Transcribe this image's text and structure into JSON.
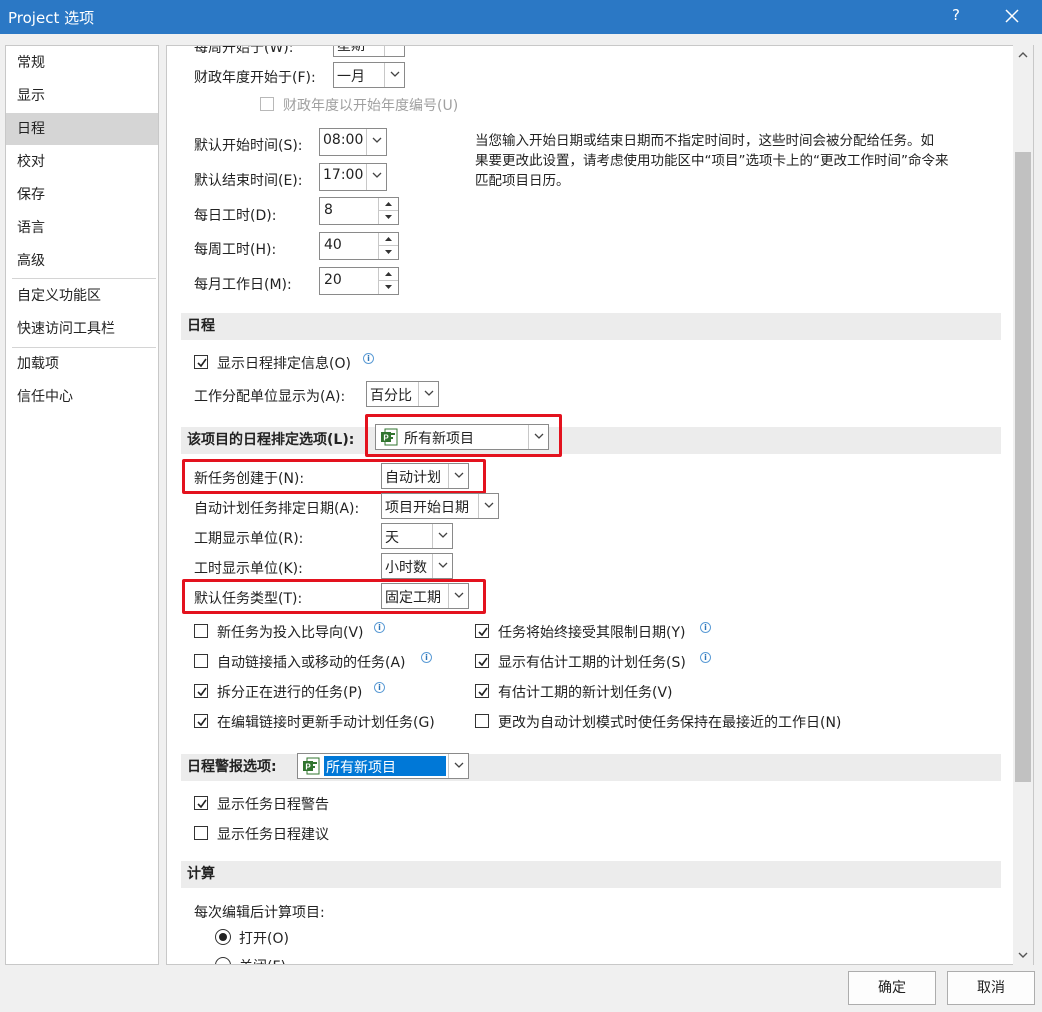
{
  "window": {
    "title": "Project 选项",
    "help": "?"
  },
  "nav": {
    "items": [
      "常规",
      "显示",
      "日程",
      "校对",
      "保存",
      "语言",
      "高级",
      "自定义功能区",
      "快速访问工具栏",
      "加载项",
      "信任中心"
    ],
    "selected": "日程"
  },
  "calendar": {
    "week_start_label": "每周开始于(W):",
    "week_start_value": "星期",
    "fiscal_start_label": "财政年度开始于(F):",
    "fiscal_start_value": "一月",
    "fiscal_numbering_label": "财政年度以开始年度编号(U)",
    "default_start_label": "默认开始时间(S):",
    "default_start_value": "08:00",
    "default_end_label": "默认结束时间(E):",
    "default_end_value": "17:00",
    "hours_day_label": "每日工时(D):",
    "hours_day_value": "8",
    "hours_week_label": "每周工时(H):",
    "hours_week_value": "40",
    "days_month_label": "每月工作日(M):",
    "days_month_value": "20",
    "note": [
      "当您输入开始日期或结束日期而不指定时间时，这些时间会被分配给任务。如",
      "果要更改此设置，请考虑使用功能区中“项目”选项卡上的“更改工作时间”命令来",
      "匹配项目日历。"
    ]
  },
  "schedule": {
    "header": "日程",
    "show_msgs_label": "显示日程排定信息(O)",
    "assign_units_label": "工作分配单位显示为(A):",
    "assign_units_value": "百分比"
  },
  "project_sched": {
    "header": "该项目的日程排定选项(L):",
    "project_value": "所有新项目",
    "new_tasks_label": "新任务创建于(N):",
    "new_tasks_value": "自动计划",
    "auto_date_label": "自动计划任务排定日期(A):",
    "auto_date_value": "项目开始日期",
    "duration_units_label": "工期显示单位(R):",
    "duration_units_value": "天",
    "work_units_label": "工时显示单位(K):",
    "work_units_value": "小时数",
    "default_type_label": "默认任务类型(T):",
    "default_type_value": "固定工期",
    "opt_effort": "新任务为投入比导向(V)",
    "opt_autolink": "自动链接插入或移动的任务(A)",
    "opt_split": "拆分正在进行的任务(P)",
    "opt_update_manual": "在编辑链接时更新手动计划任务(G)",
    "opt_honor": "任务将始终接受其限制日期(Y)",
    "opt_show_est": "显示有估计工期的计划任务(S)",
    "opt_new_est": "有估计工期的新计划任务(V)",
    "opt_keep_nearest": "更改为自动计划模式时使任务保持在最接近的工作日(N)"
  },
  "alerts": {
    "header": "日程警报选项:",
    "project_value": "所有新项目",
    "show_warnings": "显示任务日程警告",
    "show_suggestions": "显示任务日程建议"
  },
  "calc": {
    "header": "计算",
    "after_edit_label": "每次编辑后计算项目:",
    "on_label": "打开(O)",
    "off_label": "关闭(F)"
  },
  "buttons": {
    "ok": "确定",
    "cancel": "取消"
  },
  "colors": {
    "titlebar": "#2b78c5",
    "highlight": "#e3121e",
    "selection": "#0078d7"
  }
}
